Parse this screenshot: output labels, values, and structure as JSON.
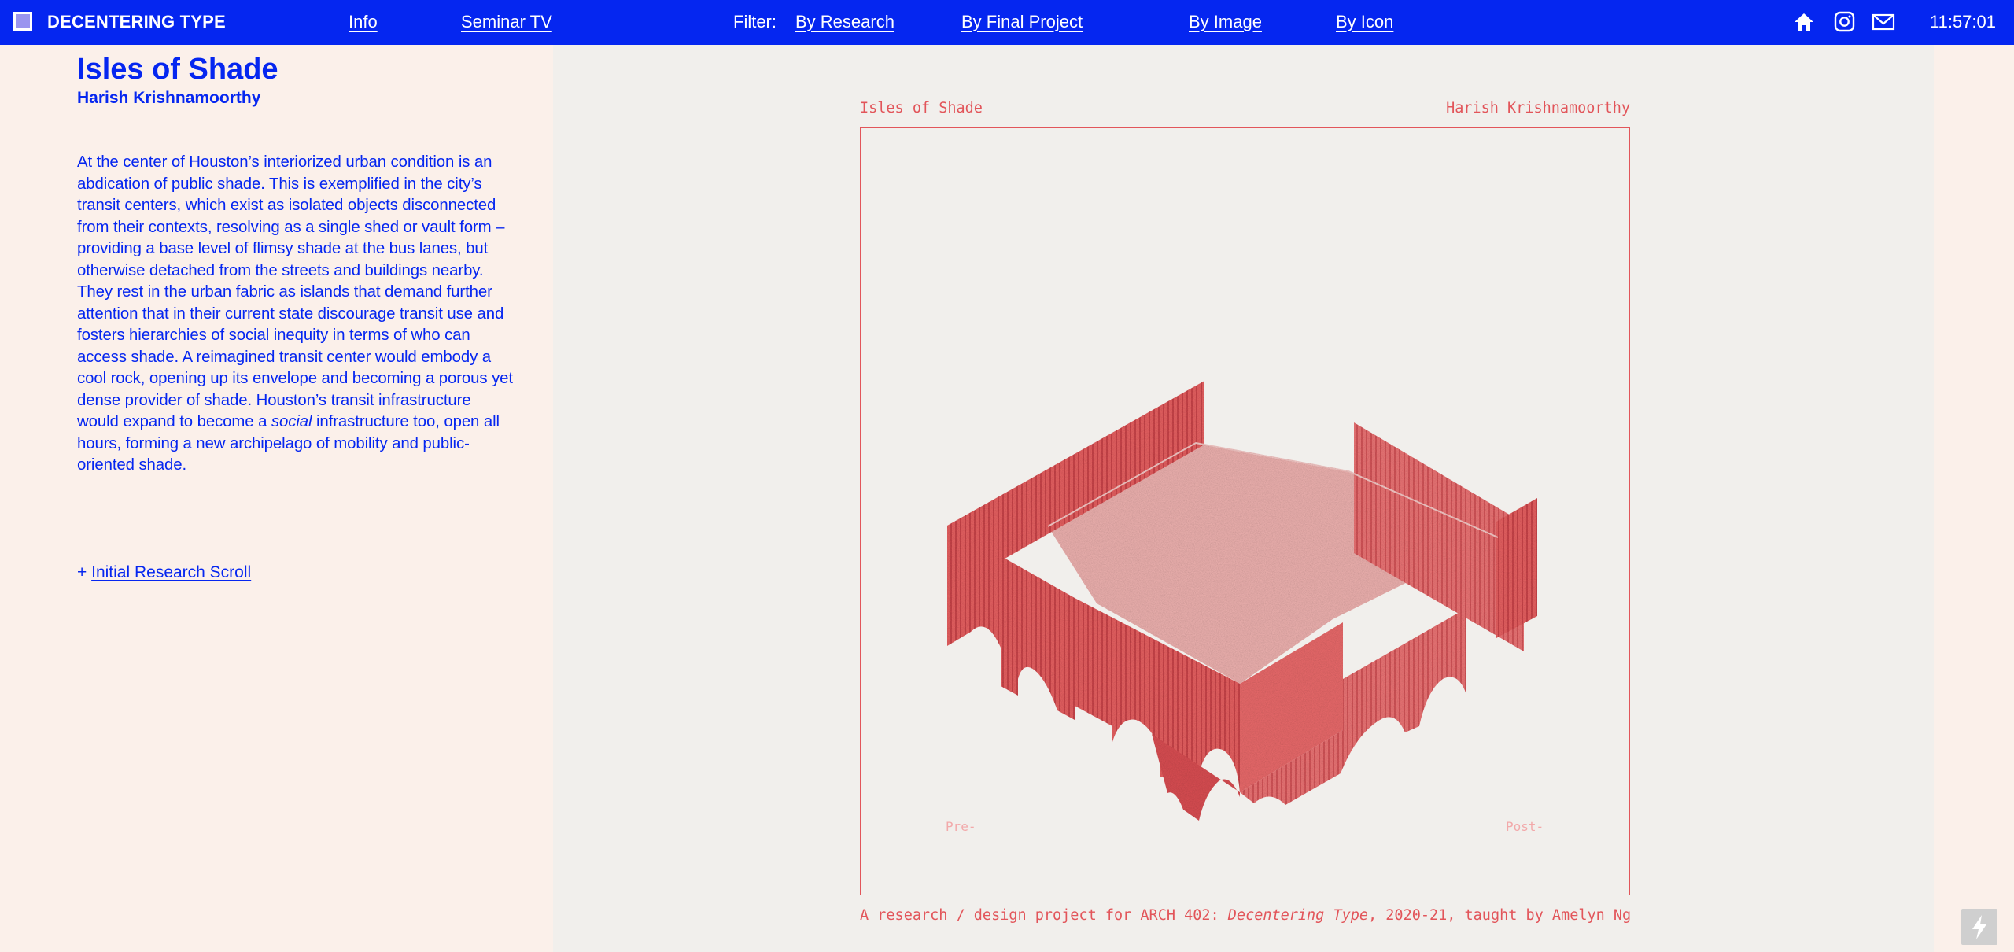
{
  "nav": {
    "brand": "DECENTERING TYPE",
    "links": {
      "info": "Info",
      "seminar_tv": "Seminar TV"
    },
    "filter_label": "Filter:",
    "filters": {
      "research": "By Research",
      "final_project": "By Final Project",
      "image": "By Image",
      "icon": "By Icon"
    },
    "icons": [
      "home-icon",
      "instagram-icon",
      "mail-icon"
    ],
    "clock": "11:57:01"
  },
  "project": {
    "title": "Isles of Shade",
    "author": "Harish Krishnamoorthy",
    "description_before_italic": "At the center of Houston’s interiorized urban condition is an abdication of public shade. This is exemplified in the city’s transit centers, which exist as isolated objects disconnected from their contexts, resolving as a single shed or vault form – providing a base level of flimsy shade at the bus lanes, but otherwise detached from the streets and buildings nearby. They rest in the urban fabric as islands that demand further attention that in their current state discourage transit use and fosters hierarchies of social inequity in terms of who can access shade. A reimagined transit center would embody a cool rock, opening up its envelope and becoming a porous yet dense provider of shade. Houston’s transit infrastructure would expand to become a ",
    "description_italic": "social",
    "description_after_italic": " infrastructure too, open all hours, forming a new archipelago of mobility and public-oriented shade.",
    "research_link_prefix": "+ ",
    "research_link": "Initial Research Scroll"
  },
  "viewer": {
    "caption_left": "Isles of Shade",
    "caption_right": "Harish Krishnamoorthy",
    "slider_pre": "Pre-",
    "slider_post": "Post-",
    "footer_before": "A research / design project for ARCH 402: ",
    "footer_italic": "Decentering Type",
    "footer_after": ", 2020-21, taught by Amelyn Ng"
  },
  "colors": {
    "nav_blue": "#0526f0",
    "text_blue": "#0526f0",
    "accent_red": "#e2555a",
    "page_bg": "#fbf0ea",
    "viewer_bg": "#f1efec"
  }
}
